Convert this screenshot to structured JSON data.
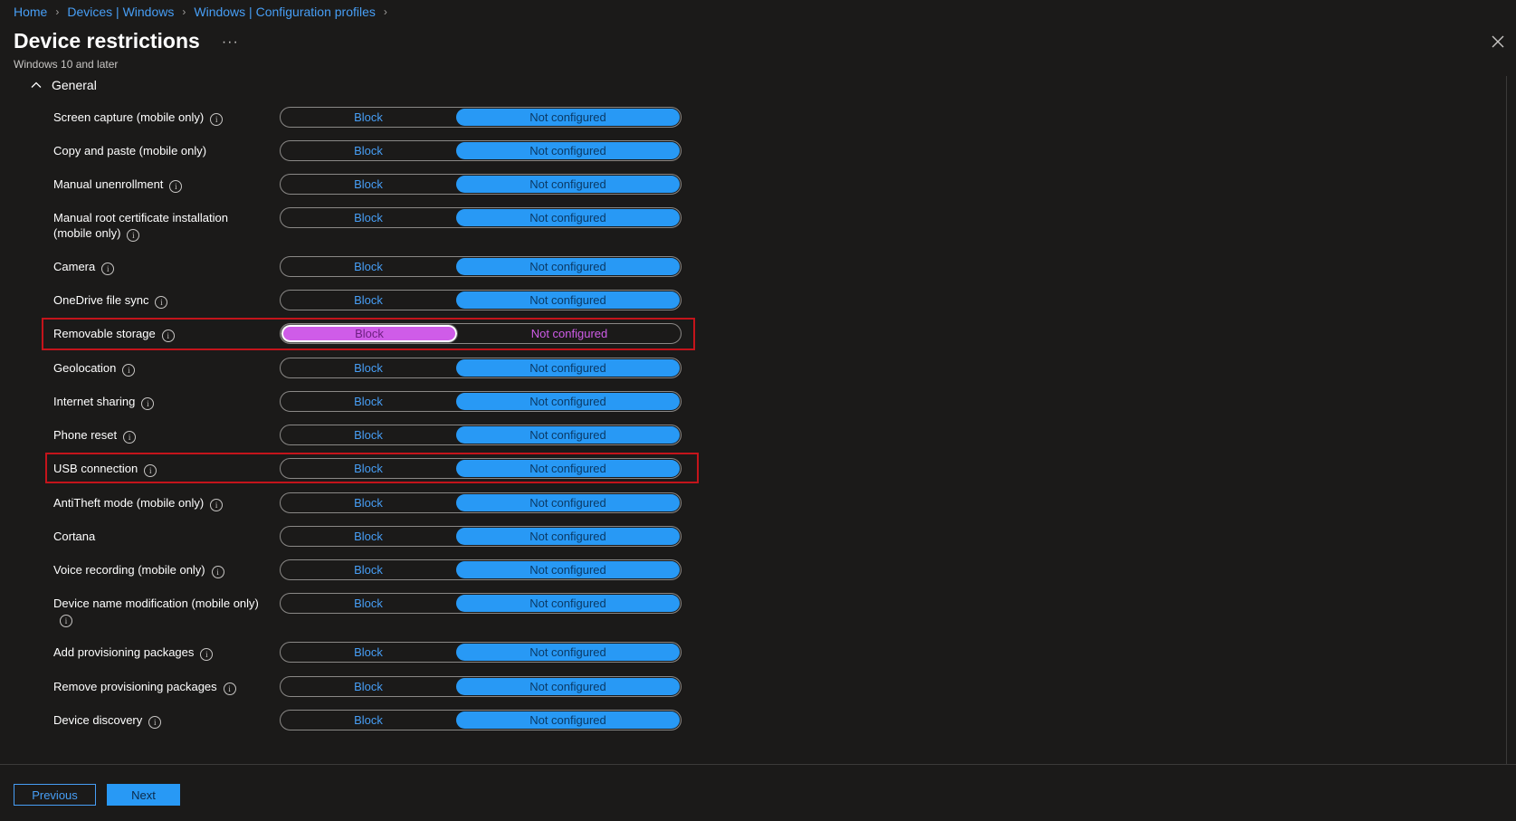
{
  "breadcrumb": [
    "Home",
    "Devices | Windows",
    "Windows | Configuration profiles"
  ],
  "title": "Device restrictions",
  "more": "···",
  "subtitle": "Windows 10 and later",
  "section": "General",
  "option_block": "Block",
  "option_not_configured": "Not configured",
  "colors": {
    "accent": "#2899f5",
    "link": "#479ef5",
    "selected_block": "#cf5ce8",
    "highlight": "#c4141b",
    "background": "#1b1a19"
  },
  "settings": [
    {
      "label": "Screen capture (mobile only)",
      "info": true,
      "selected": "Not configured",
      "highlighted": false
    },
    {
      "label": "Copy and paste (mobile only)",
      "info": false,
      "selected": "Not configured",
      "highlighted": false
    },
    {
      "label": "Manual unenrollment",
      "info": true,
      "selected": "Not configured",
      "highlighted": false
    },
    {
      "label": "Manual root certificate installation (mobile only)",
      "info": true,
      "selected": "Not configured",
      "highlighted": false
    },
    {
      "label": "Camera",
      "info": true,
      "selected": "Not configured",
      "highlighted": false
    },
    {
      "label": "OneDrive file sync",
      "info": true,
      "selected": "Not configured",
      "highlighted": false
    },
    {
      "label": "Removable storage",
      "info": true,
      "selected": "Block",
      "highlighted": true
    },
    {
      "label": "Geolocation",
      "info": true,
      "selected": "Not configured",
      "highlighted": false
    },
    {
      "label": "Internet sharing",
      "info": true,
      "selected": "Not configured",
      "highlighted": false
    },
    {
      "label": "Phone reset",
      "info": true,
      "selected": "Not configured",
      "highlighted": false
    },
    {
      "label": "USB connection",
      "info": true,
      "selected": "Not configured",
      "highlighted": true
    },
    {
      "label": "AntiTheft mode (mobile only)",
      "info": true,
      "selected": "Not configured",
      "highlighted": false
    },
    {
      "label": "Cortana",
      "info": false,
      "selected": "Not configured",
      "highlighted": false
    },
    {
      "label": "Voice recording (mobile only)",
      "info": true,
      "selected": "Not configured",
      "highlighted": false
    },
    {
      "label": "Device name modification (mobile only)",
      "info": true,
      "selected": "Not configured",
      "highlighted": false
    },
    {
      "label": "Add provisioning packages",
      "info": true,
      "selected": "Not configured",
      "highlighted": false
    },
    {
      "label": "Remove provisioning packages",
      "info": true,
      "selected": "Not configured",
      "highlighted": false
    },
    {
      "label": "Device discovery",
      "info": true,
      "selected": "Not configured",
      "highlighted": false
    }
  ],
  "footer": {
    "previous": "Previous",
    "next": "Next"
  }
}
